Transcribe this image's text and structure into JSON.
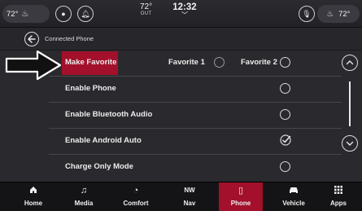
{
  "status": {
    "left_temp": "72°",
    "outside_temp": "72°",
    "outside_label": "OUT",
    "clock": "12:32",
    "clock_chevron": "﹀",
    "right_temp": "72°"
  },
  "header": {
    "breadcrumb": "Connected Phone"
  },
  "rows": [
    {
      "label": "Make Favorite",
      "fav1": "Favorite 1",
      "fav2": "Favorite 2"
    },
    {
      "label": "Enable Phone"
    },
    {
      "label": "Enable Bluetooth Audio"
    },
    {
      "label": "Enable Android Auto",
      "checked": true
    },
    {
      "label": "Charge Only Mode"
    }
  ],
  "nav": [
    {
      "label": "Home",
      "icon": "home-icon",
      "glyph": "🏠︎"
    },
    {
      "label": "Media",
      "icon": "music-note-icon",
      "glyph": "♫"
    },
    {
      "label": "Comfort",
      "icon": "comfort-dial-icon",
      "glyph": "◔"
    },
    {
      "label": "Nav",
      "icon": "compass-icon",
      "glyph": "NW"
    },
    {
      "label": "Phone",
      "icon": "phone-icon",
      "glyph": "▯",
      "active": true
    },
    {
      "label": "Vehicle",
      "icon": "car-icon",
      "glyph": "🚘︎"
    },
    {
      "label": "Apps",
      "icon": "apps-grid-icon",
      "glyph": "⠿"
    }
  ],
  "colors": {
    "accent": "#a3102b",
    "background": "#2a2a2e"
  }
}
